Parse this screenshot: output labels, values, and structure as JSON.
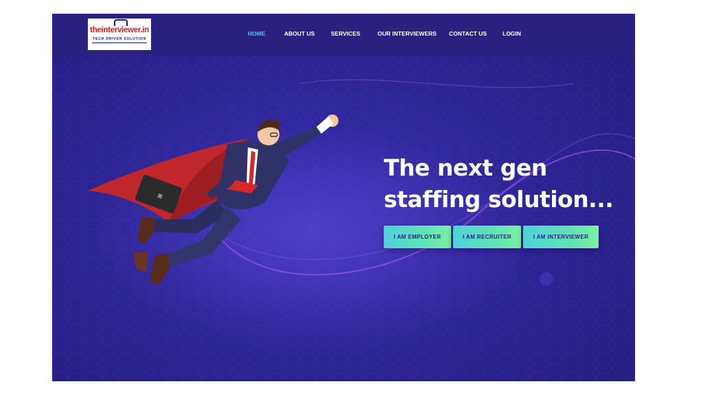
{
  "logo": {
    "text": "theinterviewer.in",
    "tagline": "TECH DRIVEN SOLUTION"
  },
  "nav": {
    "items": [
      {
        "label": "HOME",
        "active": true
      },
      {
        "label": "ABOUT US",
        "active": false
      },
      {
        "label": "SERVICES",
        "active": false
      },
      {
        "label": "OUR INTERVIEWERS",
        "active": false
      },
      {
        "label": "CONTACT US",
        "active": false
      },
      {
        "label": "LOGIN",
        "active": false
      }
    ]
  },
  "hero": {
    "headline_line1": "The next gen",
    "headline_line2": "staffing solution...",
    "buttons": [
      {
        "label": "I AM EMPLOYER"
      },
      {
        "label": "I AM RECRUITER"
      },
      {
        "label": "I AM INTERVIEWER"
      }
    ],
    "illustration": "flying-superhero-businessman"
  },
  "colors": {
    "background": "#2e2596",
    "navbar": "#2a2080",
    "active_link": "#4fc3f7",
    "button_gradient_start": "#4fd1d9",
    "button_gradient_end": "#7cf0a0",
    "logo_text": "#e01919"
  }
}
